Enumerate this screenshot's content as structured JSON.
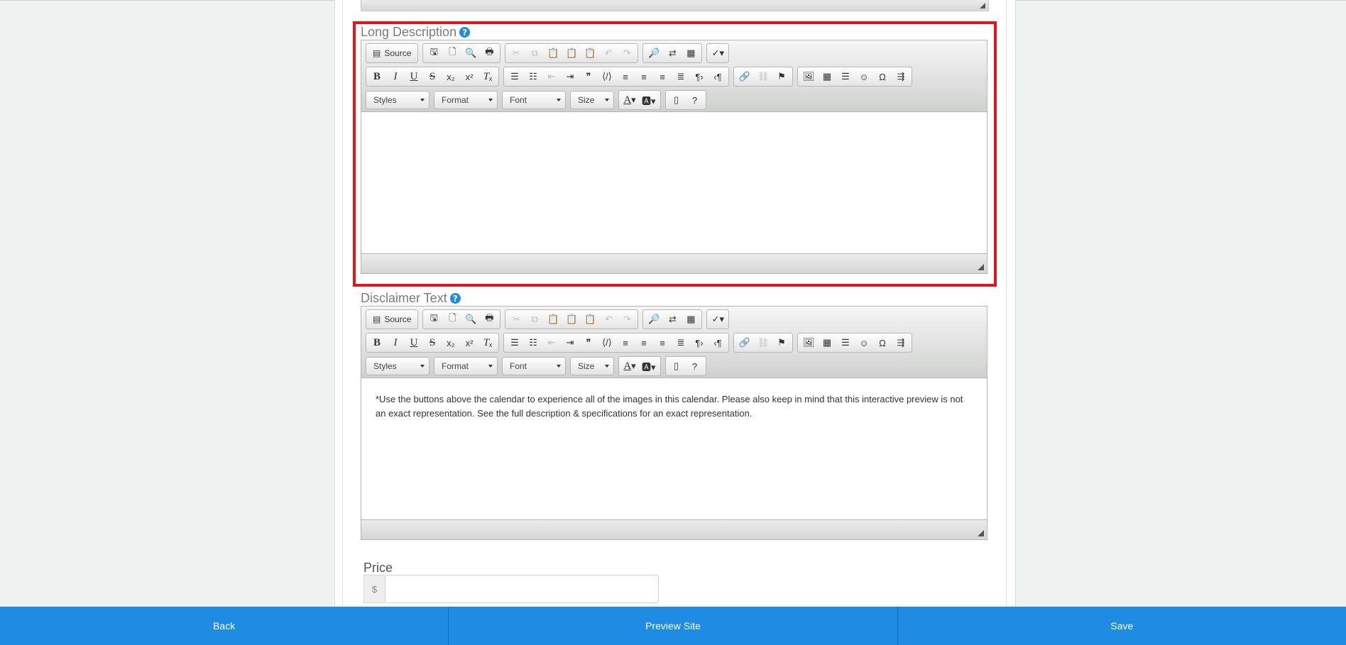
{
  "long_description": {
    "label": "Long Description",
    "help": "?",
    "content": ""
  },
  "disclaimer": {
    "label": "Disclaimer Text",
    "help": "?",
    "content": "*Use the buttons above the calendar to experience all of the images in this calendar. Please also keep in mind that this interactive preview is not an exact representation. See the full description & specifications for an exact representation."
  },
  "toolbar": {
    "source": "Source",
    "styles": "Styles",
    "format": "Format",
    "font": "Font",
    "size": "Size",
    "help": "?"
  },
  "price": {
    "label": "Price",
    "currency": "$",
    "value": ""
  },
  "footer": {
    "back": "Back",
    "preview": "Preview Site",
    "save": "Save"
  },
  "colors": {
    "accent": "#1e8ce3",
    "highlight": "#e3151f"
  }
}
